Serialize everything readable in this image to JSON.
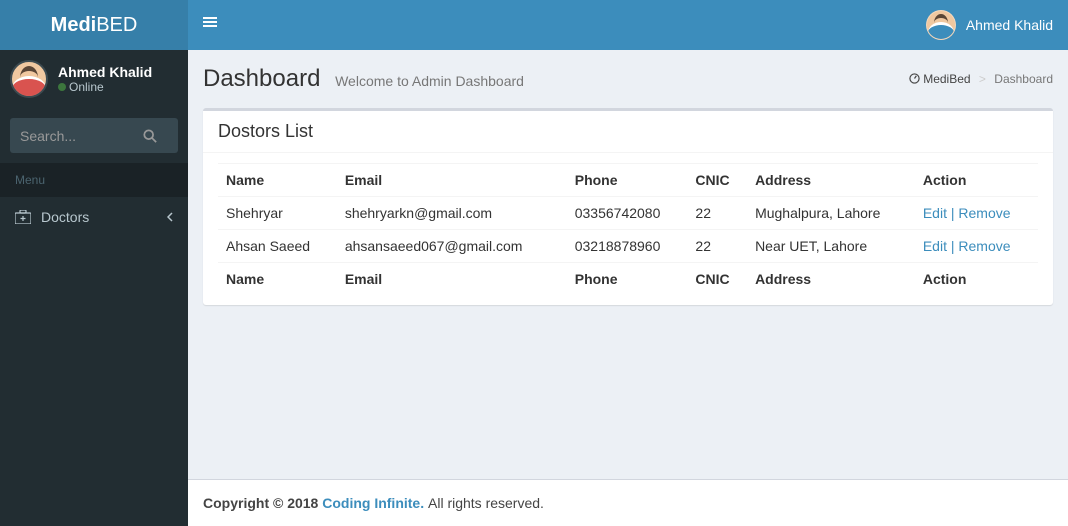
{
  "brand": {
    "part1": "Medi",
    "part2": "BED"
  },
  "user": {
    "name": "Ahmed Khalid",
    "status": "Online"
  },
  "search": {
    "placeholder": "Search..."
  },
  "sidebar": {
    "menu_header": "Menu",
    "items": [
      {
        "label": "Doctors"
      }
    ]
  },
  "page": {
    "title": "Dashboard",
    "subtitle": "Welcome to Admin Dashboard"
  },
  "breadcrumb": {
    "home": "MediBed",
    "current": "Dashboard"
  },
  "box": {
    "title": "Dostors List"
  },
  "table": {
    "headers": {
      "name": "Name",
      "email": "Email",
      "phone": "Phone",
      "cnic": "CNIC",
      "address": "Address",
      "action": "Action"
    },
    "rows": [
      {
        "name": "Shehryar",
        "email": "shehryarkn@gmail.com",
        "phone": "03356742080",
        "cnic": "22",
        "address": "Mughalpura, Lahore"
      },
      {
        "name": "Ahsan Saeed",
        "email": "ahsansaeed067@gmail.com",
        "phone": "03218878960",
        "cnic": "22",
        "address": "Near UET, Lahore"
      }
    ],
    "actions": {
      "edit": "Edit",
      "remove": "Remove"
    }
  },
  "footer": {
    "copyright_prefix": "Copyright © 2018 ",
    "link_text": "Coding Infinite.",
    "suffix": " All rights reserved."
  }
}
